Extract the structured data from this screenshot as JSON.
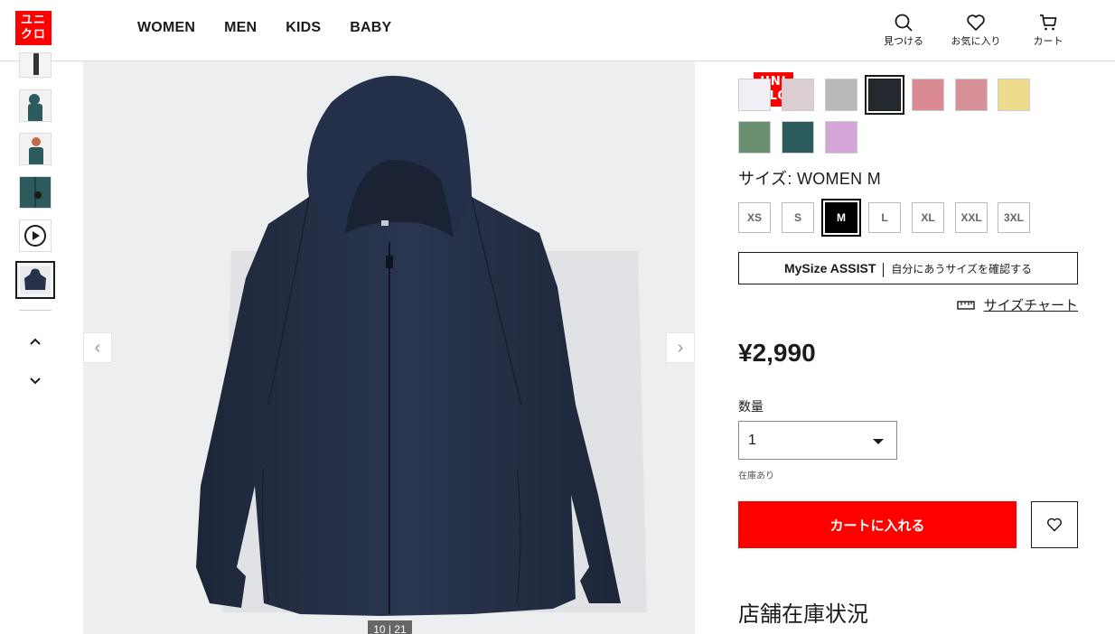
{
  "brand": {
    "logo_left": [
      "ユニ",
      "クロ"
    ],
    "logo_right": [
      "UNI",
      "QLO"
    ],
    "color": "#ff0000"
  },
  "nav": [
    "WOMEN",
    "MEN",
    "KIDS",
    "BABY"
  ],
  "header_icons": [
    {
      "icon": "search-icon",
      "label": "見つける"
    },
    {
      "icon": "heart-icon",
      "label": "お気に入り"
    },
    {
      "icon": "cart-icon",
      "label": "カート"
    }
  ],
  "gallery": {
    "counter": "10 | 21",
    "prev_arrow": "‹",
    "next_arrow": "›"
  },
  "colors": [
    {
      "hex": "#eef0f6"
    },
    {
      "hex": "#dccfd3"
    },
    {
      "hex": "#b9b9b9"
    },
    {
      "hex": "#23292e",
      "selected": true
    },
    {
      "hex": "#d98a92"
    },
    {
      "hex": "#d78f98"
    },
    {
      "hex": "#ecdc8c"
    },
    {
      "hex": "#6a8f6f"
    },
    {
      "hex": "#2c5c5e"
    },
    {
      "hex": "#d4a7d8"
    }
  ],
  "size": {
    "title": "サイズ:  WOMEN M",
    "options": [
      "XS",
      "S",
      "M",
      "L",
      "XL",
      "XXL",
      "3XL"
    ],
    "selected": "M"
  },
  "mysize": {
    "brand": "MySize ASSIST",
    "desc": "自分にあうサイズを確認する"
  },
  "size_chart_link": "サイズチャート",
  "price": "¥2,990",
  "quantity": {
    "label": "数量",
    "value": "1"
  },
  "stock_status": "在庫あり",
  "add_to_cart": "カートに入れる",
  "store_stock_title": "店舗在庫状況"
}
